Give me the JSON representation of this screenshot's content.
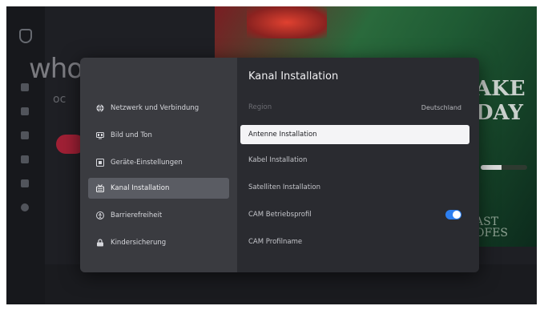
{
  "background": {
    "heading": "who",
    "subheading": "oc",
    "poster_text_line1": "AKE",
    "poster_text_line2": "DAY",
    "poster_text_bottom1": "AST",
    "poster_text_bottom2": "OFES",
    "progress": 0.45
  },
  "settings_menu": {
    "items": [
      {
        "label": "Netzwerk und Verbindung",
        "icon": "globe-icon"
      },
      {
        "label": "Bild und Ton",
        "icon": "picture-sound-icon"
      },
      {
        "label": "Geräte-Einstellungen",
        "icon": "device-settings-icon"
      },
      {
        "label": "Kanal Installation",
        "icon": "antenna-icon",
        "selected": true
      },
      {
        "label": "Barrierefreiheit",
        "icon": "accessibility-icon"
      },
      {
        "label": "Kindersicherung",
        "icon": "lock-icon"
      }
    ]
  },
  "panel": {
    "title": "Kanal Installation",
    "options": [
      {
        "label": "Region",
        "value": "Deutschland",
        "disabled": true
      },
      {
        "label": "Antenne Installation",
        "focused": true
      },
      {
        "label": "Kabel Installation"
      },
      {
        "label": "Satelliten Installation"
      },
      {
        "label": "CAM Betriebsprofil",
        "toggle": true
      },
      {
        "label": "CAM Profilname"
      }
    ]
  },
  "colors": {
    "accent": "#2d7ff0",
    "dialog_left": "#3a3b40",
    "dialog_right": "#2a2b30",
    "selected_item": "#5a5c63"
  }
}
